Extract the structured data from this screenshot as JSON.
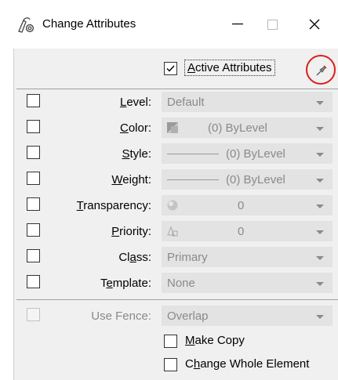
{
  "window": {
    "title": "Change Attributes",
    "minimize_glyph": "—",
    "maximize_glyph": "□",
    "close_glyph": "✕"
  },
  "active_attributes": {
    "label": "Active Attributes",
    "checked": true
  },
  "pin": {
    "icon": "pin-icon",
    "highlight_color": "#d9201c"
  },
  "rows": [
    {
      "key": "level",
      "label": "Level:",
      "mnemonic": "L",
      "value": "Default",
      "checked": false
    },
    {
      "key": "color",
      "label": "Color:",
      "mnemonic": "C",
      "value": "(0) ByLevel",
      "checked": false
    },
    {
      "key": "style",
      "label": "Style:",
      "mnemonic": "S",
      "value": "(0) ByLevel",
      "checked": false
    },
    {
      "key": "weight",
      "label": "Weight:",
      "mnemonic": "W",
      "value": "(0) ByLevel",
      "checked": false
    },
    {
      "key": "transparency",
      "label": "Transparency:",
      "mnemonic": "T",
      "value": "0",
      "checked": false
    },
    {
      "key": "priority",
      "label": "Priority:",
      "mnemonic": "P",
      "value": "0",
      "checked": false
    },
    {
      "key": "class",
      "label": "Class:",
      "mnemonic": "a",
      "value": "Primary",
      "checked": false
    },
    {
      "key": "template",
      "label": "Template:",
      "mnemonic": "e",
      "value": "None",
      "checked": false
    }
  ],
  "use_fence": {
    "label": "Use Fence:",
    "value": "Overlap",
    "checked": false,
    "enabled": false
  },
  "make_copy": {
    "label": "Make Copy",
    "mnemonic": "M",
    "checked": false
  },
  "change_whole_element": {
    "label": "Change Whole Element",
    "mnemonic": "h",
    "checked": false
  }
}
